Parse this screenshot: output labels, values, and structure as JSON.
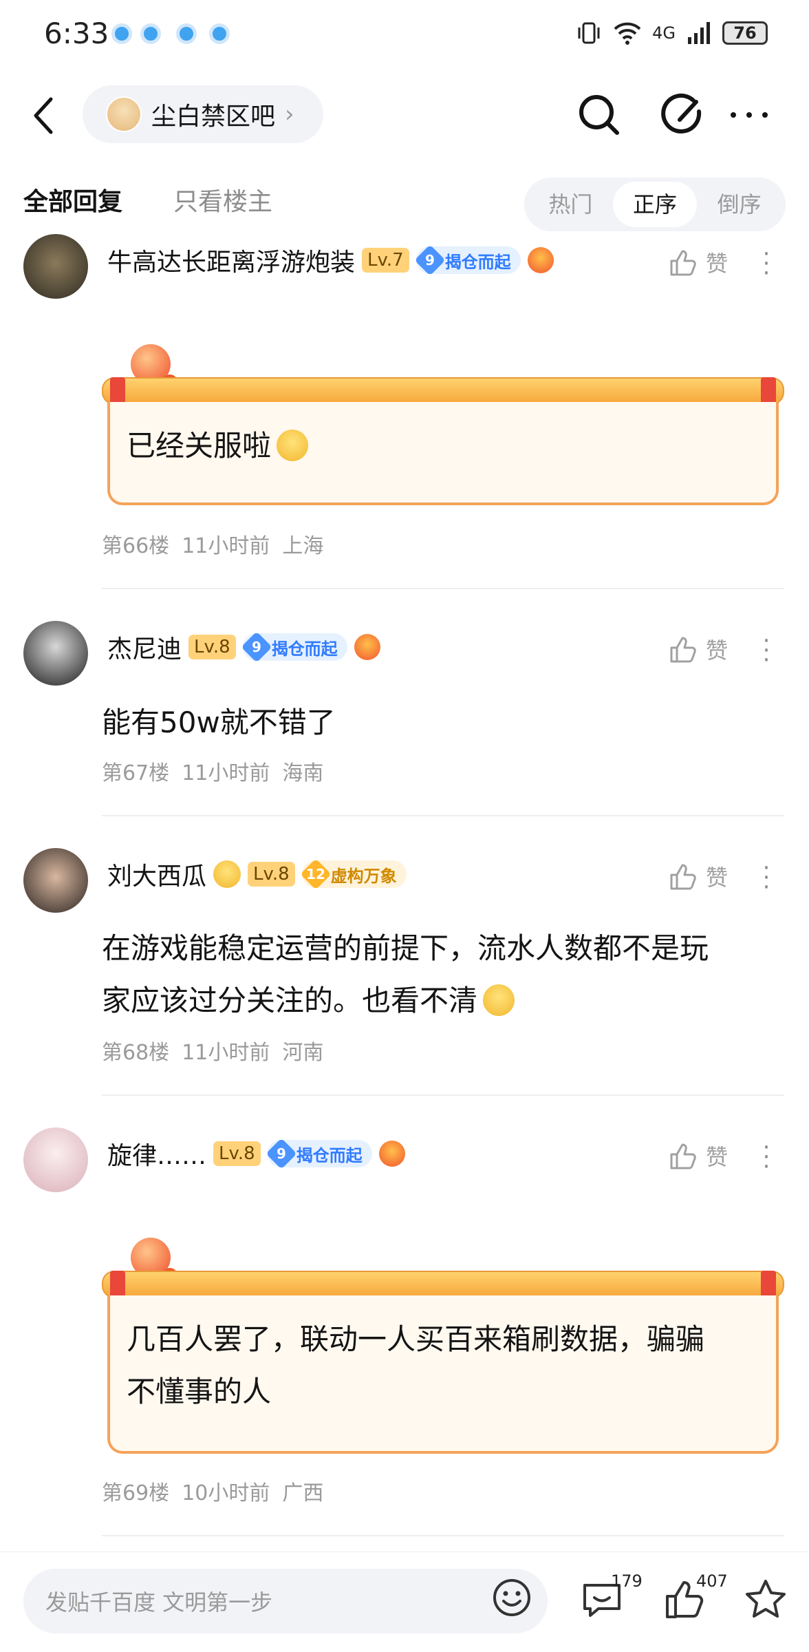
{
  "status_bar": {
    "time": "6:33",
    "network": "4G",
    "battery": "76"
  },
  "nav": {
    "forum_name": "尘白禁区吧",
    "chevron": "›"
  },
  "tabs": {
    "all": "全部回复",
    "op_only": "只看楼主",
    "sort": [
      "热门",
      "正序",
      "倒序"
    ],
    "active_sort": "正序"
  },
  "posts": [
    {
      "user": "牛高达长距离浮游炮装",
      "level": "Lv.7",
      "honor_num": "9",
      "honor": "揭仓而起",
      "like": "赞",
      "content": "已经关服啦",
      "scroll": true,
      "floor": "第66楼",
      "time": "11小时前",
      "loc": "上海"
    },
    {
      "user": "杰尼迪",
      "level": "Lv.8",
      "honor_num": "9",
      "honor": "揭仓而起",
      "like": "赞",
      "content": "能有50w就不错了",
      "scroll": false,
      "floor": "第67楼",
      "time": "11小时前",
      "loc": "海南"
    },
    {
      "user": "刘大西瓜",
      "level": "Lv.8",
      "honor_num": "12",
      "honor": "虚构万象",
      "like": "赞",
      "content_line1": "在游戏能稳定运营的前提下，流水人数都不是玩",
      "content_line2": "家应该过分关注的。也看不清",
      "scroll": false,
      "floor": "第68楼",
      "time": "11小时前",
      "loc": "河南"
    },
    {
      "user": "旋律……",
      "level": "Lv.8",
      "honor_num": "9",
      "honor": "揭仓而起",
      "like": "赞",
      "content_line1": "几百人罢了，联动一人买百来箱刷数据，骗骗",
      "content_line2": "不懂事的人",
      "scroll": true,
      "floor": "第69楼",
      "time": "10小时前",
      "loc": "广西"
    }
  ],
  "bottom": {
    "placeholder": "发贴千百度 文明第一步",
    "comments": "179",
    "likes": "407"
  }
}
